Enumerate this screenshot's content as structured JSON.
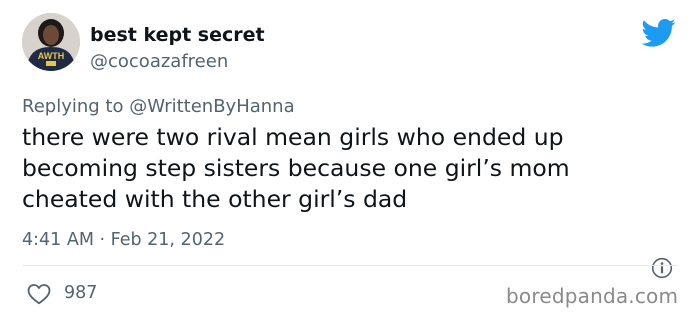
{
  "author": {
    "display_name": "best kept secret",
    "handle": "@cocoazafreen",
    "avatar_text": "AWTH"
  },
  "reply": {
    "prefix": "Replying to ",
    "user": "@WrittenByHanna"
  },
  "tweet": {
    "text": "there were two rival mean girls who ended up becoming step sisters because one girl’s mom cheated with the other girl’s dad",
    "timestamp": "4:41 AM · Feb 21, 2022"
  },
  "engagement": {
    "likes": "987"
  },
  "watermark": "boredpanda.com",
  "icons": {
    "brand": "twitter-bird-icon",
    "info": "info-icon",
    "like": "heart-icon"
  },
  "colors": {
    "twitter_blue": "#1d9bf0",
    "secondary_text": "#536471",
    "primary_text": "#0f1419"
  }
}
